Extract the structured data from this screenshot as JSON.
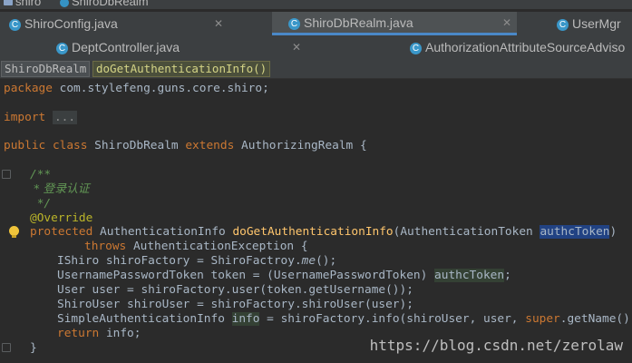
{
  "breadcrumb": {
    "folder": "shiro",
    "file": "ShiroDbRealm"
  },
  "tabs_row1": [
    {
      "label": "ShiroConfig.java",
      "active": false
    },
    {
      "label": "ShiroDbRealm.java",
      "active": true
    },
    {
      "label": "UserMgr",
      "active": false
    }
  ],
  "tabs_row2": [
    {
      "label": "DeptController.java",
      "active": false
    },
    {
      "label": "AuthorizationAttributeSourceAdviso",
      "active": false
    }
  ],
  "nav": {
    "class_name": "ShiroDbRealm",
    "method_name": "doGetAuthenticationInfo()"
  },
  "code": {
    "package_kw": "package",
    "package_name": " com.stylefeng.guns.core.shiro;",
    "import_kw": "import",
    "import_fold": "...",
    "l_class": {
      "k1": "public",
      "k2": " class",
      "name": " ShiroDbRealm ",
      "k3": "extends",
      "rest": " AuthorizingRealm {"
    },
    "c1": "/**",
    "c2": " * 登录认证",
    "c3": " */",
    "annotation": "@Override",
    "sig": {
      "kw": "protected",
      "t1": " AuthenticationInfo ",
      "fn": "doGetAuthenticationInfo",
      "t2": "(AuthenticationToken ",
      "p": "authcToken",
      "t3": ")"
    },
    "throws": {
      "kw": "throws",
      "rest": " AuthenticationException {"
    },
    "l1": {
      "a": "IShiro shiroFactory = ShiroFactroy.",
      "b": "me",
      "c": "();"
    },
    "l2": {
      "a": "UsernamePasswordToken token = (UsernamePasswordToken) ",
      "b": "authcToken",
      "c": ";"
    },
    "l3": "User user = shiroFactory.user(token.getUsername());",
    "l4": "ShiroUser shiroUser = shiroFactory.shiroUser(user);",
    "l5": {
      "a": "SimpleAuthenticationInfo ",
      "b": "info",
      "c": " = shiroFactory.info(shiroUser, user, ",
      "d": "super",
      "e": ".getName());"
    },
    "l6": {
      "kw": "return",
      "rest": " info;"
    },
    "close": "}"
  },
  "watermark": "https://blog.csdn.net/zerolaw",
  "colors": {
    "keyword": "#cc7832",
    "comment": "#629755",
    "annotation": "#bbb529",
    "method": "#ffc66d",
    "text": "#a9b7c6",
    "background": "#2b2b2b",
    "selection": "#214283"
  }
}
